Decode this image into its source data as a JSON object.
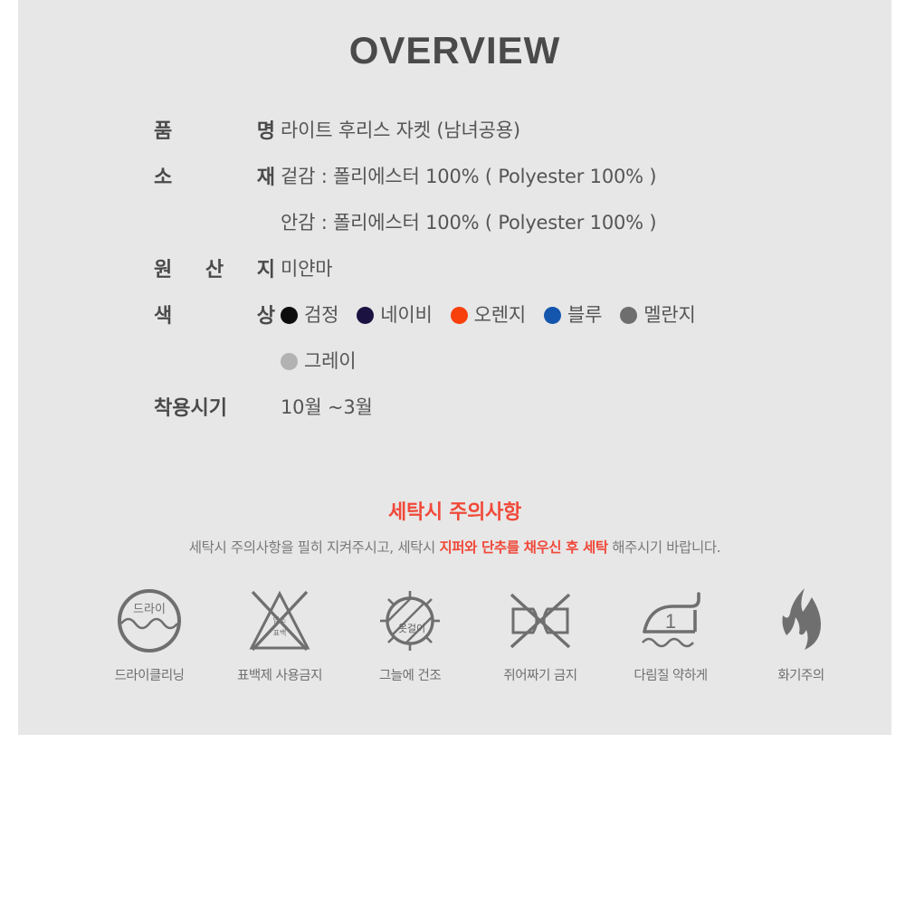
{
  "panel": {
    "background": "#e7e7e7"
  },
  "header": {
    "title": "OVERVIEW"
  },
  "spec": {
    "rows": [
      {
        "label": "품  명",
        "value": "라이트 후리스 자켓 (남녀공용)"
      },
      {
        "label": "소  재",
        "value": "겉감 : 폴리에스터 100% ( Polyester 100% )"
      },
      {
        "label": "",
        "value": "안감 : 폴리에스터 100% ( Polyester 100% )"
      },
      {
        "label": "원 산 지",
        "value": "미얀마"
      }
    ],
    "color_label": "색  상",
    "colors": [
      {
        "name": "검정",
        "hex": "#0d0d0d"
      },
      {
        "name": "네이비",
        "hex": "#1c1242"
      },
      {
        "name": "오렌지",
        "hex": "#f7400c"
      },
      {
        "name": "블루",
        "hex": "#1456ad"
      },
      {
        "name": "멜란지",
        "hex": "#6e6e6e"
      },
      {
        "name": "그레이",
        "hex": "#b2b2b2"
      }
    ],
    "season_label": "착용시기",
    "season_value": "10월 ~3월"
  },
  "care": {
    "heading": "세탁시 주의사항",
    "note_before": "세탁시 주의사항을 필히 지켜주시고, 세탁시 ",
    "note_highlight": "지퍼와 단추를 채우신 후 세탁",
    "note_after": " 해주시기 바랍니다.",
    "accent_color": "#f0493a",
    "icons": [
      {
        "icon": "dry-clean-icon",
        "inner_text": "드라이",
        "caption": "드라이클리닝"
      },
      {
        "icon": "no-bleach-icon",
        "inner_text": "",
        "caption": "표백제 사용금지"
      },
      {
        "icon": "dry-in-shade-icon",
        "inner_text": "옷걸이",
        "caption": "그늘에 건조"
      },
      {
        "icon": "no-wring-icon",
        "inner_text": "",
        "caption": "쥐어짜기 금지"
      },
      {
        "icon": "iron-low-icon",
        "inner_text": "1",
        "caption": "다림질 약하게"
      },
      {
        "icon": "fire-caution-icon",
        "inner_text": "",
        "caption": "화기주의"
      }
    ]
  }
}
